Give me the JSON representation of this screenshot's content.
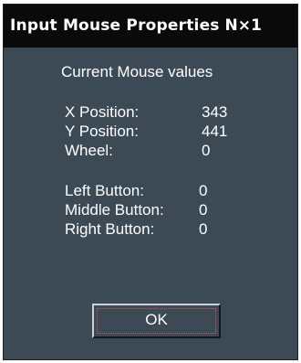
{
  "window": {
    "title": "Input Mouse Properties",
    "title_controls": "N×1"
  },
  "content": {
    "heading": "Current Mouse values",
    "rows": [
      {
        "label": "X Position:",
        "value": "343"
      },
      {
        "label": "Y Position:",
        "value": "441"
      },
      {
        "label": "Wheel:",
        "value": "0"
      },
      {
        "label": "Left Button:",
        "value": "0"
      },
      {
        "label": "Middle Button:",
        "value": "0"
      },
      {
        "label": "Right Button:",
        "value": "0"
      }
    ]
  },
  "buttons": {
    "ok_label": "OK"
  },
  "colors": {
    "panel": "#3c4a56",
    "titlebar": "#0a0a0a",
    "text": "#ffffff",
    "focus": "#d9534f"
  }
}
